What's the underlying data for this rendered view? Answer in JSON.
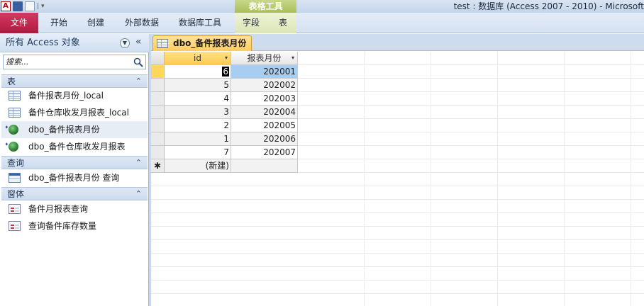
{
  "window": {
    "title": "test : 数据库 (Access 2007 - 2010)  -  Microsoft",
    "context_header": "表格工具",
    "qat_separator": "|",
    "qat_dropdown": "▾"
  },
  "ribbon": {
    "tabs": [
      {
        "label": "文件"
      },
      {
        "label": "开始"
      },
      {
        "label": "创建"
      },
      {
        "label": "外部数据"
      },
      {
        "label": "数据库工具"
      },
      {
        "label": "字段"
      },
      {
        "label": "表"
      }
    ]
  },
  "nav": {
    "title": "所有 Access 对象",
    "search_placeholder": "搜索...",
    "menu_glyph": "▼",
    "collapse_glyph": "«",
    "groups": [
      {
        "label": "表",
        "chevron": "⌃",
        "items": [
          {
            "label": "备件报表月份_local",
            "icon": "table-icon"
          },
          {
            "label": "备件仓库收发月报表_local",
            "icon": "table-icon"
          },
          {
            "label": "dbo_备件报表月份",
            "icon": "linked-table-icon",
            "selected": true
          },
          {
            "label": "dbo_备件仓库收发月报表",
            "icon": "linked-table-icon"
          }
        ]
      },
      {
        "label": "查询",
        "chevron": "⌃",
        "items": [
          {
            "label": "dbo_备件报表月份 查询",
            "icon": "query-icon"
          }
        ]
      },
      {
        "label": "窗体",
        "chevron": "⌃",
        "items": [
          {
            "label": "备件月报表查询",
            "icon": "form-icon"
          },
          {
            "label": "查询备件库存数量",
            "icon": "form-icon"
          }
        ]
      }
    ]
  },
  "document": {
    "tab_label": "dbo_备件报表月份",
    "columns": [
      {
        "label": "id",
        "sort_glyph": "▾"
      },
      {
        "label": "报表月份",
        "sort_glyph": "▾"
      }
    ],
    "rows": [
      {
        "id": "6",
        "month": "202001"
      },
      {
        "id": "5",
        "month": "202002"
      },
      {
        "id": "4",
        "month": "202003"
      },
      {
        "id": "3",
        "month": "202004"
      },
      {
        "id": "2",
        "month": "202005"
      },
      {
        "id": "1",
        "month": "202006"
      },
      {
        "id": "7",
        "month": "202007"
      }
    ],
    "new_row_marker": "✱",
    "new_row_label": "(新建)"
  },
  "colors": {
    "file_tab": "#c52549",
    "context_tab": "#a9bf57",
    "doc_tab": "#ffcd5e",
    "selected_cell": "#a7cdf0",
    "nav_header": "#d0dff1"
  }
}
